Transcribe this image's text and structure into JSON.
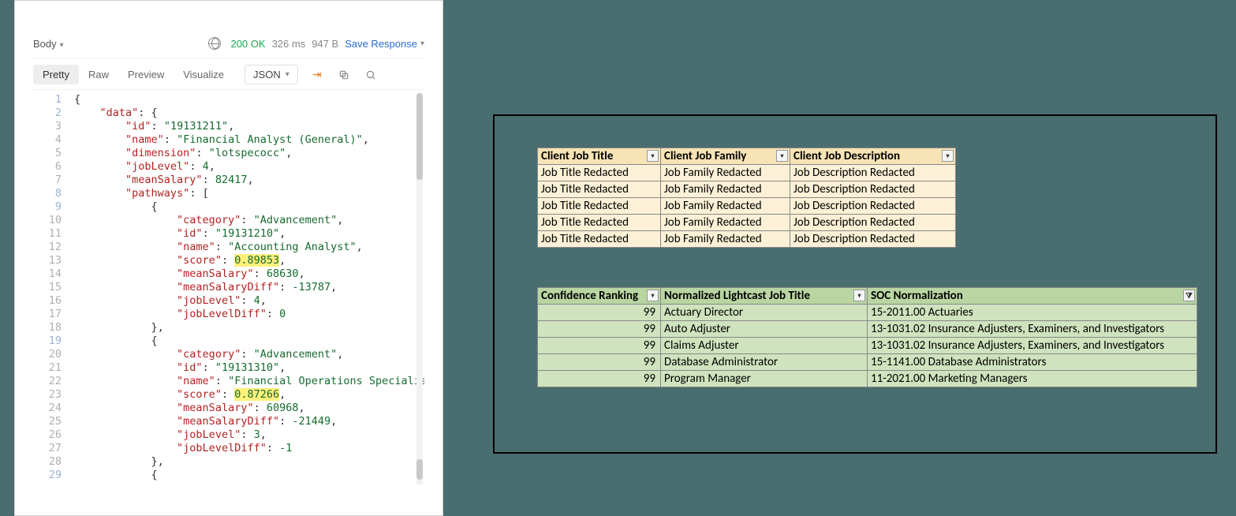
{
  "postman": {
    "body_label": "Body",
    "status_code": "200 OK",
    "latency": "326 ms",
    "size": "947 B",
    "save_label": "Save Response",
    "view_tabs": {
      "pretty": "Pretty",
      "raw": "Raw",
      "preview": "Preview",
      "visualize": "Visualize"
    },
    "format_label": "JSON",
    "code_lines": [
      "{",
      "    \"data\": {",
      "        \"id\": \"19131211\",",
      "        \"name\": \"Financial Analyst (General)\",",
      "        \"dimension\": \"lotspecocc\",",
      "        \"jobLevel\": 4,",
      "        \"meanSalary\": 82417,",
      "        \"pathways\": [",
      "            {",
      "                \"category\": \"Advancement\",",
      "                \"id\": \"19131210\",",
      "                \"name\": \"Accounting Analyst\",",
      "                \"score\": 0.89853,",
      "                \"meanSalary\": 68630,",
      "                \"meanSalaryDiff\": -13787,",
      "                \"jobLevel\": 4,",
      "                \"jobLevelDiff\": 0",
      "            },",
      "            {",
      "                \"category\": \"Advancement\",",
      "                \"id\": \"19131310\",",
      "                \"name\": \"Financial Operations Specialist\",",
      "                \"score\": 0.87266,",
      "                \"meanSalary\": 60968,",
      "                \"meanSalaryDiff\": -21449,",
      "                \"jobLevel\": 3,",
      "                \"jobLevelDiff\": -1",
      "            },",
      "            {"
    ],
    "highlight_lines": [
      13,
      23
    ],
    "json_data": {
      "data": {
        "id": "19131211",
        "name": "Financial Analyst (General)",
        "dimension": "lotspecocc",
        "jobLevel": 4,
        "meanSalary": 82417,
        "pathways": [
          {
            "category": "Advancement",
            "id": "19131210",
            "name": "Accounting Analyst",
            "score": 0.89853,
            "meanSalary": 68630,
            "meanSalaryDiff": -13787,
            "jobLevel": 4,
            "jobLevelDiff": 0
          },
          {
            "category": "Advancement",
            "id": "19131310",
            "name": "Financial Operations Specialist",
            "score": 0.87266,
            "meanSalary": 60968,
            "meanSalaryDiff": -21449,
            "jobLevel": 3,
            "jobLevelDiff": -1
          }
        ]
      }
    }
  },
  "tables": {
    "client": {
      "headers": [
        "Client Job Title",
        "Client Job Family",
        "Client Job Description"
      ],
      "rows": [
        [
          "Job Title Redacted",
          "Job Family Redacted",
          "Job Description Redacted"
        ],
        [
          "Job Title Redacted",
          "Job Family Redacted",
          "Job Description Redacted"
        ],
        [
          "Job Title Redacted",
          "Job Family Redacted",
          "Job Description Redacted"
        ],
        [
          "Job Title Redacted",
          "Job Family Redacted",
          "Job Description Redacted"
        ],
        [
          "Job Title Redacted",
          "Job Family Redacted",
          "Job Description Redacted"
        ]
      ]
    },
    "normalized": {
      "headers": [
        "Confidence Ranking",
        "Normalized Lightcast Job Title",
        "SOC Normalization"
      ],
      "rows": [
        [
          "99",
          "Actuary Director",
          "15-2011.00 Actuaries"
        ],
        [
          "99",
          "Auto Adjuster",
          "13-1031.02 Insurance Adjusters, Examiners, and Investigators"
        ],
        [
          "99",
          "Claims Adjuster",
          "13-1031.02 Insurance Adjusters, Examiners, and Investigators"
        ],
        [
          "99",
          "Database Administrator",
          "15-1141.00 Database Administrators"
        ],
        [
          "99",
          "Program Manager",
          "11-2021.00 Marketing Managers"
        ]
      ]
    }
  }
}
